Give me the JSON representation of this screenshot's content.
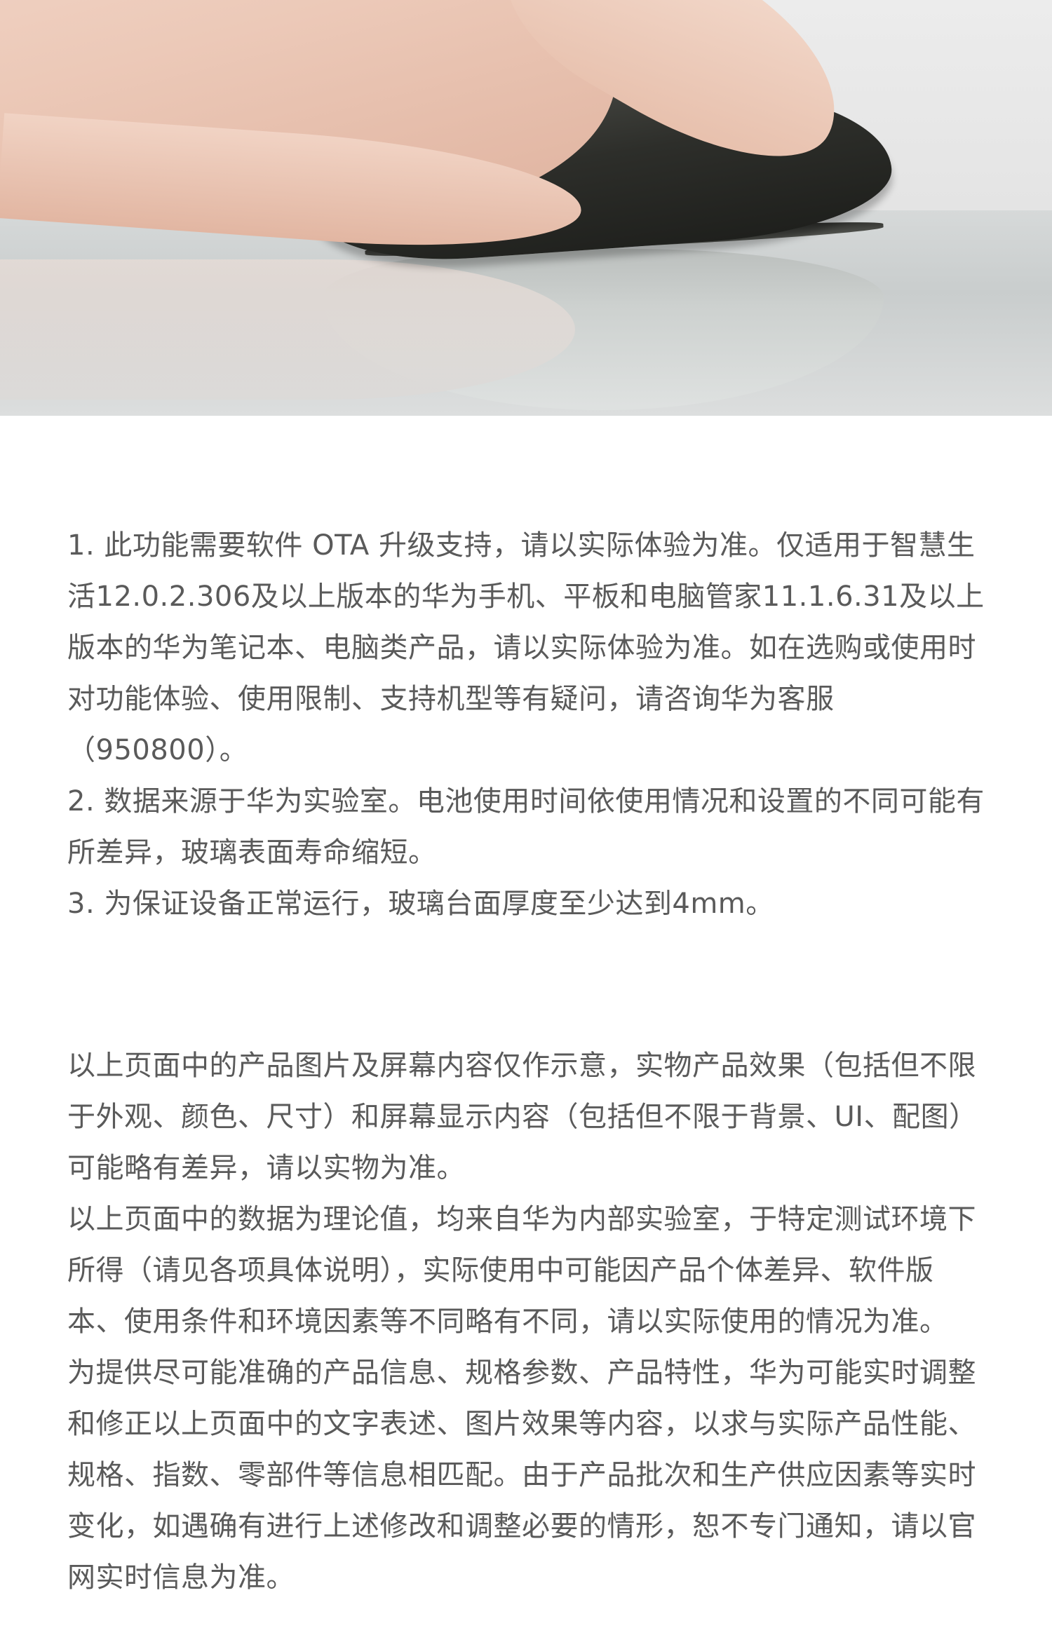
{
  "hero": {
    "icon": "product-photo-mouse-in-hand"
  },
  "notes": [
    "1. 此功能需要软件 OTA 升级支持，请以实际体验为准。仅适用于智慧生活12.0.2.306及以上版本的华为手机、平板和电脑管家11.1.6.31及以上版本的华为笔记本、电脑类产品，请以实际体验为准。如在选购或使用时对功能体验、使用限制、支持机型等有疑问，请咨询华为客服（950800）。",
    "2. 数据来源于华为实验室。电池使用时间依使用情况和设置的不同可能有所差异，玻璃表面寿命缩短。",
    "3. 为保证设备正常运行，玻璃台面厚度至少达到4mm。"
  ],
  "legal": [
    "以上页面中的产品图片及屏幕内容仅作示意，实物产品效果（包括但不限于外观、颜色、尺寸）和屏幕显示内容（包括但不限于背景、UI、配图）可能略有差异，请以实物为准。",
    "以上页面中的数据为理论值，均来自华为内部实验室，于特定测试环境下所得（请见各项具体说明），实际使用中可能因产品个体差异、软件版本、使用条件和环境因素等不同略有不同，请以实际使用的情况为准。",
    "为提供尽可能准确的产品信息、规格参数、产品特性，华为可能实时调整和修正以上页面中的文字表述、图片效果等内容，以求与实际产品性能、规格、指数、零部件等信息相匹配。由于产品批次和生产供应因素等实时变化，如遇确有进行上述修改和调整必要的情形，恕不专门通知，请以官网实时信息为准。"
  ]
}
